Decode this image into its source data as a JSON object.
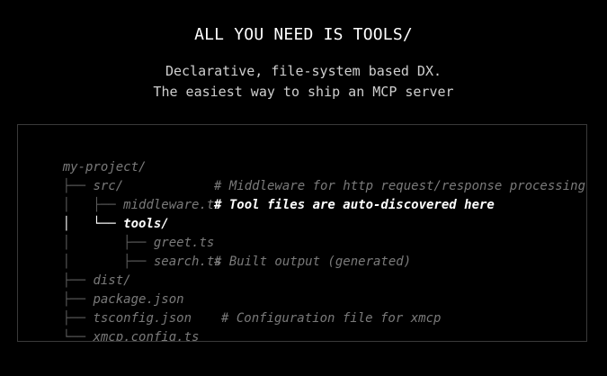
{
  "hero": {
    "title": "ALL YOU NEED IS TOOLS/",
    "subtitle_line1": "Declarative, file-system based DX.",
    "subtitle_line2": "The easiest way to ship an MCP server"
  },
  "tree": {
    "lines": [
      {
        "branch": "",
        "name": "my-project/",
        "comment": ""
      },
      {
        "branch": "├── ",
        "name": "src/",
        "comment": ""
      },
      {
        "branch": "│   ├── ",
        "name": "middleware.ts",
        "comment": "# Middleware for http request/response processing"
      },
      {
        "branch": "│   └── ",
        "name": "tools/",
        "comment": "# Tool files are auto-discovered here"
      },
      {
        "branch": "│       ├── ",
        "name": "greet.ts",
        "comment": ""
      },
      {
        "branch": "│       ├── ",
        "name": "search.ts",
        "comment": ""
      },
      {
        "branch": "├── ",
        "name": "dist/",
        "comment": "# Built output (generated)"
      },
      {
        "branch": "├── ",
        "name": "package.json",
        "comment": ""
      },
      {
        "branch": "├── ",
        "name": "tsconfig.json",
        "comment": ""
      },
      {
        "branch": "└── ",
        "name": "xmcp.config.ts",
        "comment": "# Configuration file for xmcp"
      }
    ]
  }
}
